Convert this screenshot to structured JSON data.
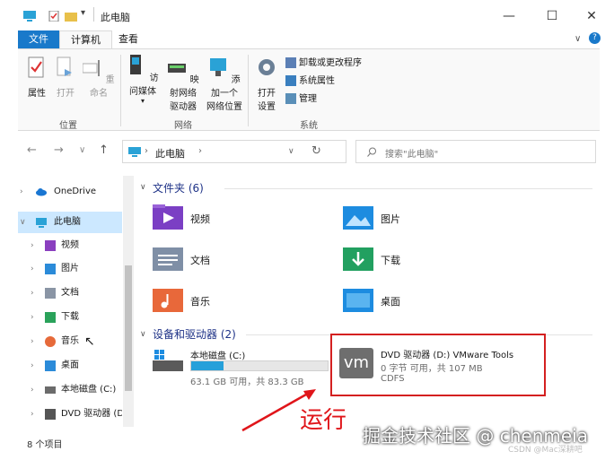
{
  "window": {
    "title": "此电脑",
    "minimize": "—",
    "maximize": "☐",
    "close": "✕"
  },
  "tabs": {
    "file": "文件",
    "computer": "计算机",
    "view": "查看"
  },
  "ribbon": {
    "location": {
      "label": "位置",
      "properties": "属性",
      "open": "打开",
      "rename": "重命名"
    },
    "network": {
      "label": "网络",
      "access_media": "访问媒体",
      "map_drive_1": "映射网络",
      "map_drive_2": "驱动器",
      "add_location_1": "添加一个",
      "add_location_2": "网络位置"
    },
    "system": {
      "label": "系统",
      "open_settings_1": "打开",
      "open_settings_2": "设置",
      "uninstall": "卸载或更改程序",
      "system_props": "系统属性",
      "manage": "管理"
    }
  },
  "nav": {
    "back": "←",
    "forward": "→",
    "down": "∨",
    "up": "↑",
    "address": "此电脑",
    "address_chevron": "›",
    "address_dropdown": "∨",
    "refresh": "↻",
    "search_placeholder": "搜索\"此电脑\""
  },
  "sidebar": {
    "items": [
      {
        "label": "OneDrive",
        "icon": "cloud-icon",
        "color": "#1976d2"
      },
      {
        "label": "此电脑",
        "icon": "computer-icon",
        "color": "#2aa2d6"
      },
      {
        "label": "视频",
        "icon": "video-icon",
        "color": "#8a3fbf"
      },
      {
        "label": "图片",
        "icon": "picture-icon",
        "color": "#2b8bd9"
      },
      {
        "label": "文档",
        "icon": "document-icon",
        "color": "#8a95a5"
      },
      {
        "label": "下载",
        "icon": "download-icon",
        "color": "#2aa25a"
      },
      {
        "label": "音乐",
        "icon": "music-icon",
        "color": "#e66a3a"
      },
      {
        "label": "桌面",
        "icon": "desktop-icon",
        "color": "#2b8bd9"
      },
      {
        "label": "本地磁盘 (C:)",
        "icon": "disk-icon",
        "color": "#6b6b6b"
      },
      {
        "label": "DVD 驱动器 (D",
        "icon": "dvd-icon",
        "color": "#555555"
      }
    ]
  },
  "status": {
    "count": "8 个项目"
  },
  "content": {
    "folders_header": "文件夹 (6)",
    "folders": [
      {
        "label": "视频",
        "color": "#7b3fc4"
      },
      {
        "label": "图片",
        "color": "#1d8ce0"
      },
      {
        "label": "文档",
        "color": "#7f8fa6"
      },
      {
        "label": "下载",
        "color": "#22a060"
      },
      {
        "label": "音乐",
        "color": "#e8683a"
      },
      {
        "label": "桌面",
        "color": "#1d8ce0"
      }
    ],
    "drives_header": "设备和驱动器 (2)",
    "drive_c": {
      "name": "本地磁盘 (C:)",
      "space": "63.1 GB 可用，共 83.3 GB",
      "used_fraction": 0.24
    },
    "drive_d": {
      "name": "DVD 驱动器 (D:) VMware Tools",
      "space": "0 字节 可用，共 107 MB",
      "fs": "CDFS",
      "logo": "vm"
    }
  },
  "annotation": {
    "text": "运行",
    "color": "#e0151a"
  },
  "watermark": {
    "text": "掘金技术社区 @ chenmeia",
    "csdn": "CSDN @Mac深耕吧"
  },
  "colors": {
    "accent": "#1979ca",
    "selected": "#cce8ff",
    "header_blue": "#1e3287"
  }
}
